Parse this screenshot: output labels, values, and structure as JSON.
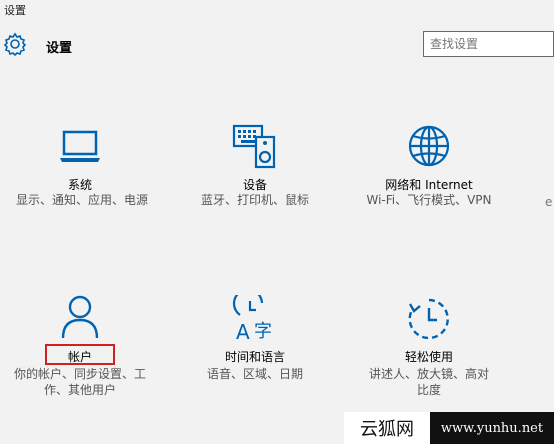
{
  "window": {
    "title": "设置"
  },
  "header": {
    "title": "设置",
    "icon": "gear-icon"
  },
  "search": {
    "placeholder": "查找设置"
  },
  "tiles": [
    {
      "id": "system",
      "label": "系统",
      "desc": "显示、通知、应用、电源",
      "icon": "laptop-icon"
    },
    {
      "id": "devices",
      "label": "设备",
      "desc": "蓝牙、打印机、鼠标",
      "icon": "devices-icon"
    },
    {
      "id": "network",
      "label": "网络和 Internet",
      "desc": "Wi-Fi、飞行模式、VPN",
      "icon": "globe-icon"
    },
    {
      "id": "accounts",
      "label": "帐户",
      "desc": "你的帐户、同步设置、工作、其他用户",
      "icon": "person-icon"
    },
    {
      "id": "time",
      "label": "时间和语言",
      "desc": "语音、区域、日期",
      "icon": "time-language-icon"
    },
    {
      "id": "ease",
      "label": "轻松使用",
      "desc": "讲述人、放大镜、高对比度",
      "icon": "ease-of-access-icon"
    }
  ],
  "partial_tile": {
    "desc": "e"
  },
  "watermark": {
    "left": "云狐网",
    "right": "www.yunhu.net"
  },
  "colors": {
    "accent": "#0063b1",
    "highlight": "#d02020",
    "background": "#f2f2f2"
  }
}
